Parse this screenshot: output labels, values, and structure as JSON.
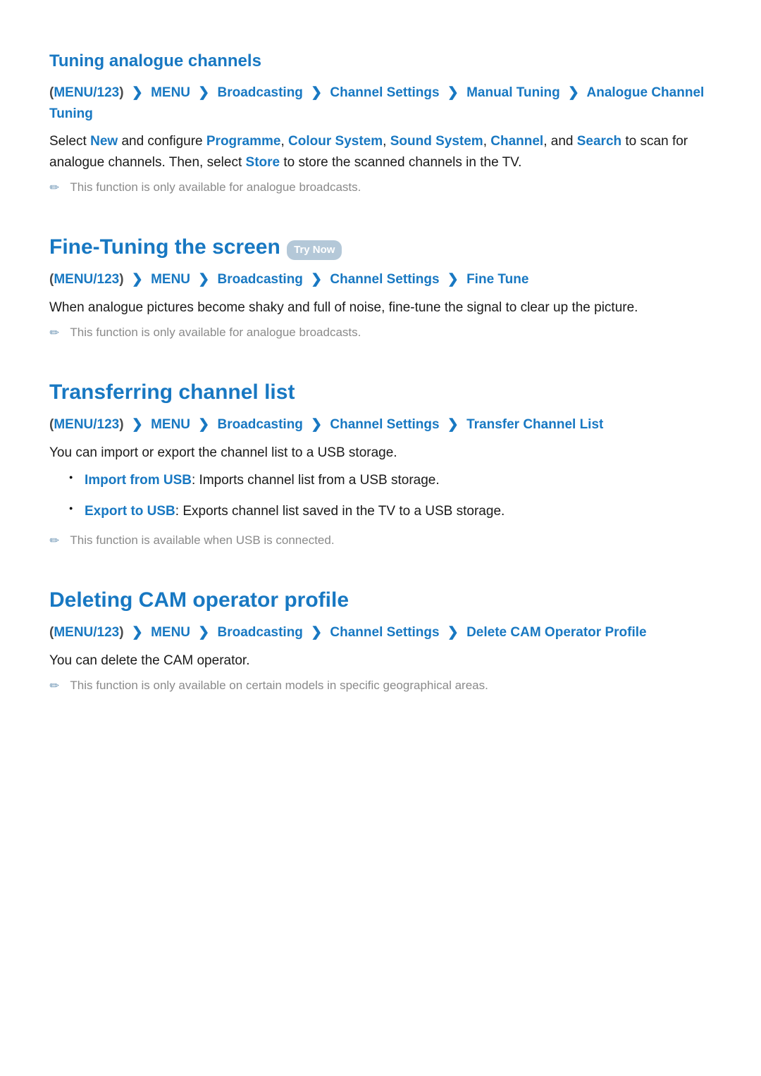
{
  "s1": {
    "title": "Tuning analogue channels",
    "bc": [
      "(",
      "MENU/123",
      ")",
      "MENU",
      "Broadcasting",
      "Channel Settings",
      "Manual Tuning",
      "Analogue Channel Tuning"
    ],
    "p1a": "Select ",
    "p1_new": "New",
    "p1b": " and configure ",
    "p1_prog": "Programme",
    "p1c": ", ",
    "p1_col": "Colour System",
    "p1d": ", ",
    "p1_snd": "Sound System",
    "p1e": ", ",
    "p1_ch": "Channel",
    "p1f": ", and ",
    "p1_srch": "Search",
    "p1g": " to scan for analogue channels. Then, select ",
    "p1_store": "Store",
    "p1h": " to store the scanned channels in the TV.",
    "note": "This function is only available for analogue broadcasts."
  },
  "s2": {
    "title": "Fine-Tuning the screen",
    "trynow": "Try Now",
    "bc": [
      "(",
      "MENU/123",
      ")",
      "MENU",
      "Broadcasting",
      "Channel Settings",
      "Fine Tune"
    ],
    "p1": "When analogue pictures become shaky and full of noise, fine-tune the signal to clear up the picture.",
    "note": "This function is only available for analogue broadcasts."
  },
  "s3": {
    "title": "Transferring channel list",
    "bc": [
      "(",
      "MENU/123",
      ")",
      "MENU",
      "Broadcasting",
      "Channel Settings",
      "Transfer Channel List"
    ],
    "p1": "You can import or export the channel list to a USB storage.",
    "li1_t": "Import from USB",
    "li1_d": ": Imports channel list from a USB storage.",
    "li2_t": "Export to USB",
    "li2_d": ": Exports channel list saved in the TV to a USB storage.",
    "note": "This function is available when USB is connected."
  },
  "s4": {
    "title": "Deleting CAM operator profile",
    "bc": [
      "(",
      "MENU/123",
      ")",
      "MENU",
      "Broadcasting",
      "Channel Settings",
      "Delete CAM Operator Profile"
    ],
    "p1": "You can delete the CAM operator.",
    "note": "This function is only available on certain models in specific geographical areas."
  },
  "icons": {
    "pencil": "✎",
    "chevron": "❯"
  }
}
